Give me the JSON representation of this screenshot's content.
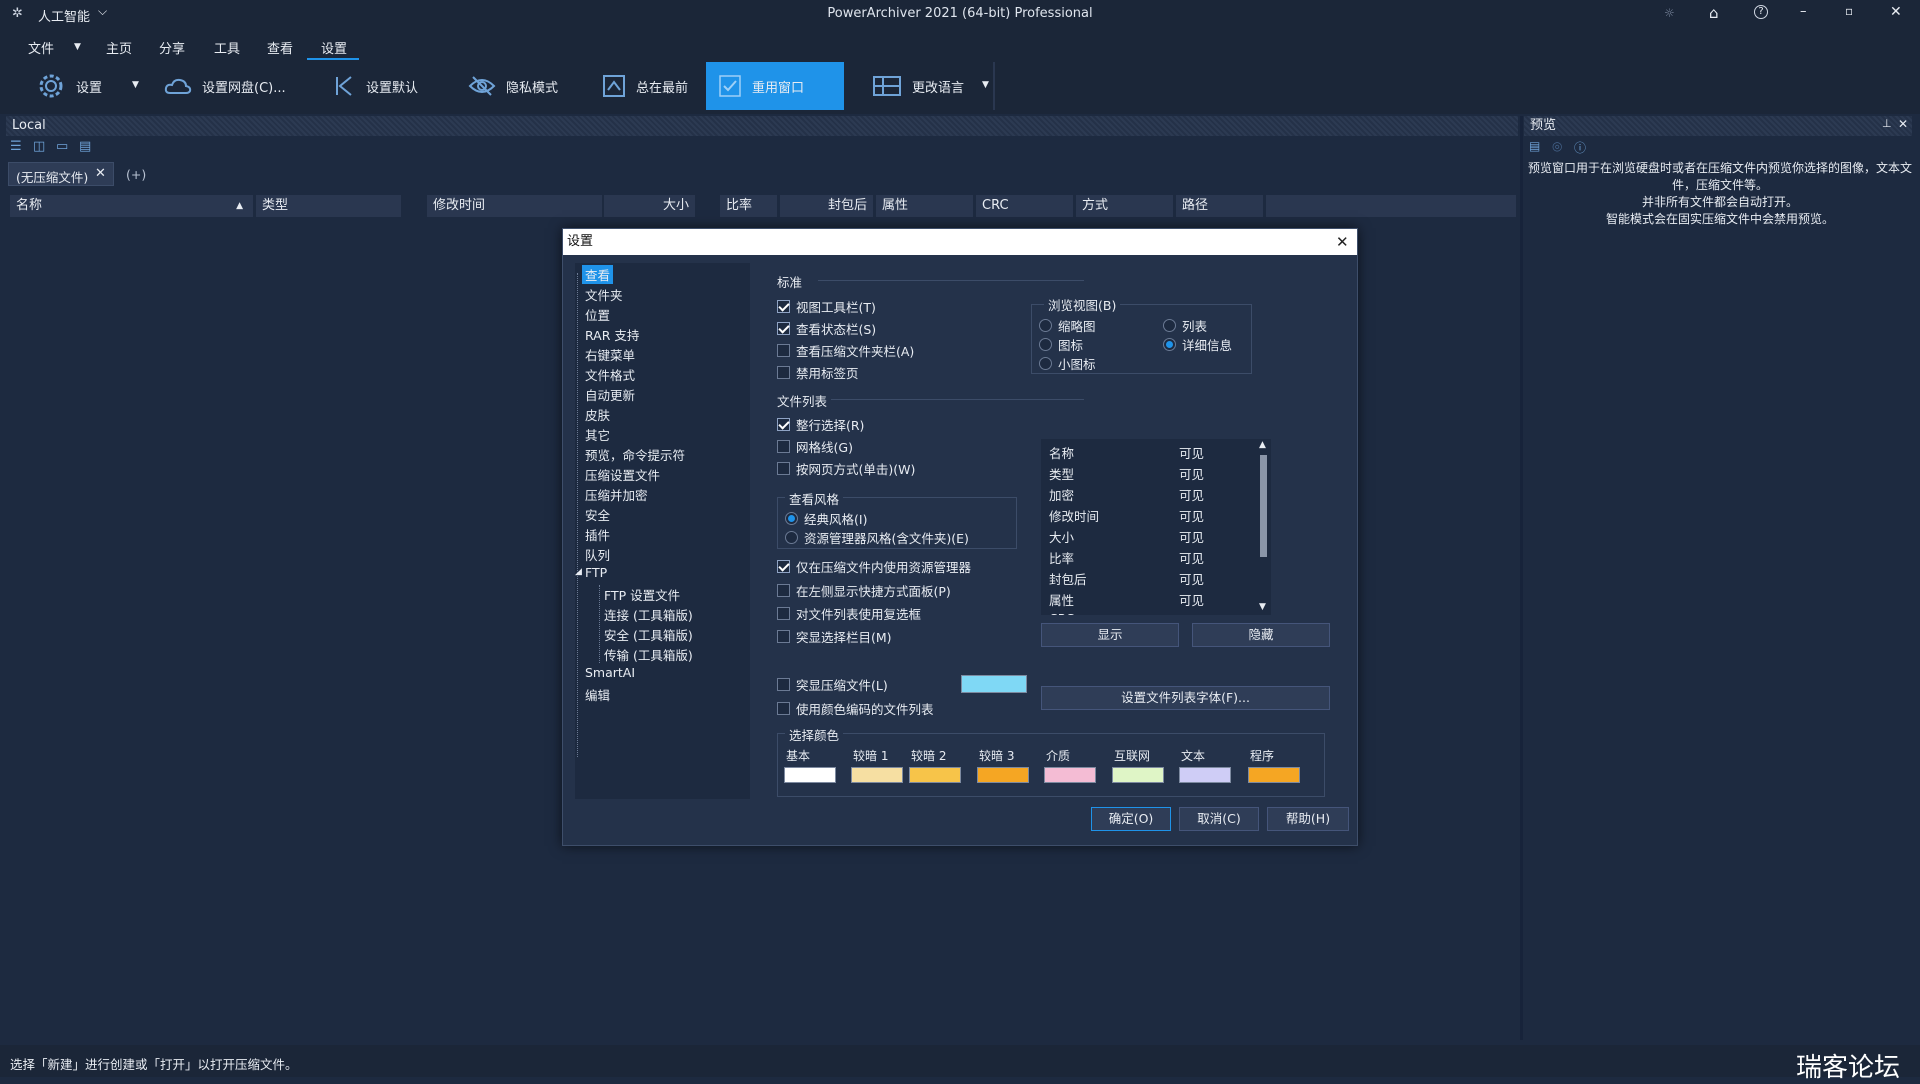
{
  "title_bar": {
    "app_menu": "人工智能",
    "window_title": "PowerArchiver 2021 (64-bit) Professional"
  },
  "menu": {
    "file": "文件",
    "home": "主页",
    "share": "分享",
    "tools": "工具",
    "view": "查看",
    "settings": "设置"
  },
  "ribbon": {
    "settings": "设置",
    "cloud": "设置网盘(C)...",
    "defaults": "设置默认",
    "privacy": "隐私模式",
    "on_top": "总在最前",
    "reuse": "重用窗口",
    "language": "更改语言"
  },
  "local_panel": {
    "title": "Local",
    "tab": "(无压缩文件)",
    "new_tab": "(+)",
    "columns": [
      "名称",
      "类型",
      "修改时间",
      "大小",
      "比率",
      "封包后",
      "属性",
      "CRC",
      "方式",
      "路径"
    ]
  },
  "preview_panel": {
    "title": "预览",
    "text": [
      "预览窗口用于在浏览硬盘时或者在压缩文件内预览你选择的图像，文本文",
      "件，压缩文件等。",
      "并非所有文件都会自动打开。",
      "智能模式会在固实压缩文件中会禁用预览。"
    ]
  },
  "status_bar": {
    "text": "选择「新建」进行创建或「打开」以打开压缩文件。"
  },
  "watermark": "瑞客论坛",
  "dialog": {
    "title": "设置",
    "tree": [
      "查看",
      "文件夹",
      "位置",
      "RAR 支持",
      "右键菜单",
      "文件格式",
      "自动更新",
      "皮肤",
      "其它",
      "预览，命令提示符",
      "压缩设置文件",
      "压缩并加密",
      "安全",
      "插件",
      "队列",
      "FTP",
      "FTP 设置文件",
      "连接 (工具箱版)",
      "安全 (工具箱版)",
      "传输 (工具箱版)",
      "SmartAI",
      "编辑"
    ],
    "standard": {
      "label": "标准",
      "view_toolbar": "视图工具栏(T)",
      "status_bar": "查看状态栏(S)",
      "archive_bar": "查看压缩文件夹栏(A)",
      "disable_tabs": "禁用标签页"
    },
    "browse_view": {
      "label": "浏览视图(B)",
      "thumbnail": "缩略图",
      "icons": "图标",
      "small_icons": "小图标",
      "list": "列表",
      "details": "详细信息"
    },
    "file_list": {
      "label": "文件列表",
      "full_row": "整行选择(R)",
      "grid_lines": "网格线(G)",
      "web_style": "按网页方式(单击)(W)"
    },
    "view_style": {
      "label": "查看风格",
      "classic": "经典风格(I)",
      "explorer": "资源管理器风格(含文件夹)(E)"
    },
    "options": {
      "explorer_in_archive": "仅在压缩文件内使用资源管理器",
      "shortcut_panel": "在左侧显示快捷方式面板(P)",
      "checkboxes": "对文件列表使用复选框",
      "highlight_column": "突显选择栏目(M)",
      "highlight_archives": "突显压缩文件(L)",
      "color_coded": "使用颜色编码的文件列表"
    },
    "columns_list": [
      [
        "名称",
        "可见"
      ],
      [
        "类型",
        "可见"
      ],
      [
        "加密",
        "可见"
      ],
      [
        "修改时间",
        "可见"
      ],
      [
        "大小",
        "可见"
      ],
      [
        "比率",
        "可见"
      ],
      [
        "封包后",
        "可见"
      ],
      [
        "属性",
        "可见"
      ],
      [
        "CRC",
        "可见"
      ]
    ],
    "show_btn": "显示",
    "hide_btn": "隐藏",
    "font_btn": "设置文件列表字体(F)...",
    "highlight_color": "#7fd8f5",
    "selection_colors": {
      "label": "选择颜色",
      "items": [
        {
          "name": "基本",
          "color": "#ffffff"
        },
        {
          "name": "较暗 1",
          "color": "#f6dfa2"
        },
        {
          "name": "较暗 2",
          "color": "#f7c449"
        },
        {
          "name": "较暗 3",
          "color": "#f5a623"
        },
        {
          "name": "介质",
          "color": "#f4bcd4"
        },
        {
          "name": "互联网",
          "color": "#dff5c6"
        },
        {
          "name": "文本",
          "color": "#cfcdf6"
        },
        {
          "name": "程序",
          "color": "#f5a623"
        }
      ]
    },
    "ok": "确定(O)",
    "cancel": "取消(C)",
    "help": "帮助(H)"
  }
}
